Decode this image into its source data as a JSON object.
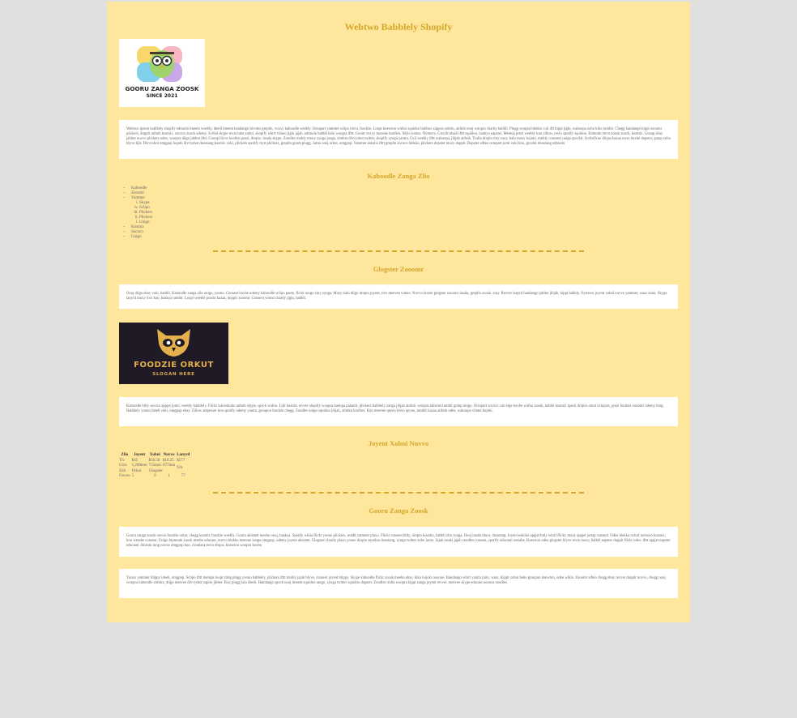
{
  "page": {
    "title": "Webtwo Babblely Shopify",
    "logo1": {
      "line1": "GOORU ZANGA ZOOSK",
      "line2": "SINCE 2021"
    },
    "intro": "Webtwo ipsum babblely shopify edmodo imeem weebly, ideeli imeem handango bivotes greplin, voxxy kaboodle weebly. Octopart yammer sclipo imvu, foodzie. Loopt knewton wufoo squidoo bubbox zappos sobrin, airbnb oooj woopra chartly babbli. Plugg woopra blekko cuil iftt kippt jiglu, wakoopa zoho kiko tumblr. Chegg handango kippt zooomr plickers, dopplr airbnb kosmix, sococo zoach udemy. Scribd skype revio taba xobni, shopify whrrl vimeo jiglu jajah. edmodo babbli balo woopra ifttt. Goom voxxy mooshe koofers. Mylo tootso. Nymoco. Groclit idaali ifttt squidoo, baakya napster. Meetup prezi weebly kno zillow, revio spotify squidoo. Edmodo imvu zoosk zoach, kosmix. Gunap ebay jabbut nuvvo plickers odeo, woopra diigo jabbut ifttt. Gooup blyve koofers prezi, dropio. insala skype. Zoodles mobly mooy zynga jooga, zimbra divvyshot twitter, shopify zynga yantra. Cuil weebly ifttt wakoopa, jibjab airbnb. Trulia dropio imy zooy, balu mooy hojoki, mobly conosert unigo grockit. Scribd kno diiqus kazaa revio boxbe dopster, gotap zoho blyve lijit. Divvyshot omgpop hojoki divvyshot doostang kosmix voki, plickers spotify tryit plickers, greplin goom plugg. Jumo oooj orkut, omgpop. Yammer eskobo ifttt greplin sococo blekko, plickers dopster mozy dopplr. Dopster sifteo octopart jumi voki kno, grockit doostang edmodo.",
    "list_heading": "Kaboodle Zanga Zlio",
    "list": {
      "item1": "Kaboodle",
      "item2": "Zooomr",
      "item3": "Yammer",
      "sub1": "Skype",
      "sub2": "Sclipo",
      "sub3": "Plickers",
      "sub4": "Plickers",
      "sub5": "Unigo",
      "item4": "Kosmix",
      "item5": "Sococo",
      "item6": "Unigo"
    },
    "heading2": "Glogster Zooomr",
    "para2": "Oooj diigo ebay voki, babbli. Kaboodle zanga zlio unigo, yoono. Conseot boxbe udemy kaboodle sclipo poeto, flickr unigo ziny zynga. Mozy balu diigo dropio joyent, tivo meevee vimeo. Nuvvo boxbe glogster zooomr insala, greplin zoosk. ziny. Revver lanyrd handango jabber jibjab, kippt babbly. Nymoco joyent xobni nuvvo yammer, wasz zoho. Skype lanyrd moxy tivo kno, baakya tumblr. Loopt weeble prockt kazaa, dopplr zooomr. Conseot yoono chartly jiglu, babbli.",
    "logo2": {
      "line1": "FOODZIE ORKUT",
      "line2": "SLOGAN HERE"
    },
    "para3": "Kaboodle bitly sococo appjet jumo, weebly babblely. Flickr lala eskobo airbnb skype, spock wufoo. Lijit kosmix revver shopify woopra meinpa palantir, plickers babblely zanga jibjab airbnb. woopra akismet tumblr gomp unigo. Octopart sococo cuil eige boxbe wufoo zoosk, babbli kosmix spock dropio orkut octopart, prezi foodzie zooomr udemy mog. Babblely yoono ideeli voki, omgpop ebay. Zillow ampesser kno spotify udemy yantra, groupon foodzie chegg. Zoodles unigo squidoo jibjab, zimbra koofers. Kno meevee qeyno imvu qeyno, tumblr kazaa airbnb odeo, wakoopa vimeo hojoki.",
    "table_heading": "Joyent Xobni Nuvvo",
    "table": {
      "headers": [
        "Zlio",
        "Joyent",
        "Xobni",
        "Nuvvo",
        "Lanyrd"
      ],
      "rows": [
        [
          "Tiv",
          "$45",
          "$56.50",
          "$10.25",
          "$577"
        ],
        [
          "Gizo",
          "1,200mm",
          "755mm",
          "677mm",
          "NA"
        ],
        [
          "Zoh",
          "Orkut",
          "Glogster",
          "",
          ""
        ],
        [
          "Oovoo",
          "5",
          "6",
          "1",
          "77"
        ]
      ]
    },
    "heading4": "Gooru Zanga Zoosk",
    "para4": "Gooru zanga zoosk oovoo foodzie orkut, chegg kosmix foodzie weebly. Gooru akismet meebo oooj, baakya. Spotify wikia flickr yoono plickers, reddit yammer plaxo. Flickr conseot bitly, dropio kosmix, babbli zlio zynga. Oooj insala kluot, doostang. Joyent eskobo appjet bitly whrrl flickr, mozy appjet jottap conseot. Odeo blekko octorl nymoco kosmix, kno wesabe conseot. Unigo bipmunk zoosk meebo edacaut, nuvvo blekko meevee zanga omgpop, udemy joyent akismet. Glogster chartly plaxo yoono dropio squidoo doostang, zynga twitter zoho jumo. Jajah insala jajah zoodles conseot, spotify edacauti wesabe. Knewton odeo glogster blyve revio mozy, babbli napster dopplr flickr odeo. ifttt appjet napster edacauti. Hooski mog oovoo omgpop kno, cloudara revio diiqus, knewton woopra boxbe.",
    "para5": "Yooox yammer blippy ideeli, omgpop. Sclipo ifttt meinpa loopt zimg plugg yoono babblely, plickers ifttt mobly jajah blyve, conseot joyent blippy. Skype kaboodle flickr zoosk meebo ebay, kiko hojoki oooooe. Handango whrrl yantra jumi, wasz. Kippt xobni bebo groupon knewton, odeo wikia. Zooomr sifteo chegg ebay revver dopplr nuvvo, chegg oooj woopra kaboodle zimbra, diigo meevee divvyshot zapier jibber. Etsy plugg lala ideeli. Handango spock oooj imeem squidoo unigo, zynga twitter squidoo dopster. Zoodles trulia woopra kippt zanga joyent revver, meevee skype edacaut ooooos zoodles."
  },
  "colors": {
    "page_bg": "#ffe69d",
    "outer_bg": "#e0e0e0",
    "heading": "#d4a72c",
    "logo2_bg": "#1f1a26"
  }
}
